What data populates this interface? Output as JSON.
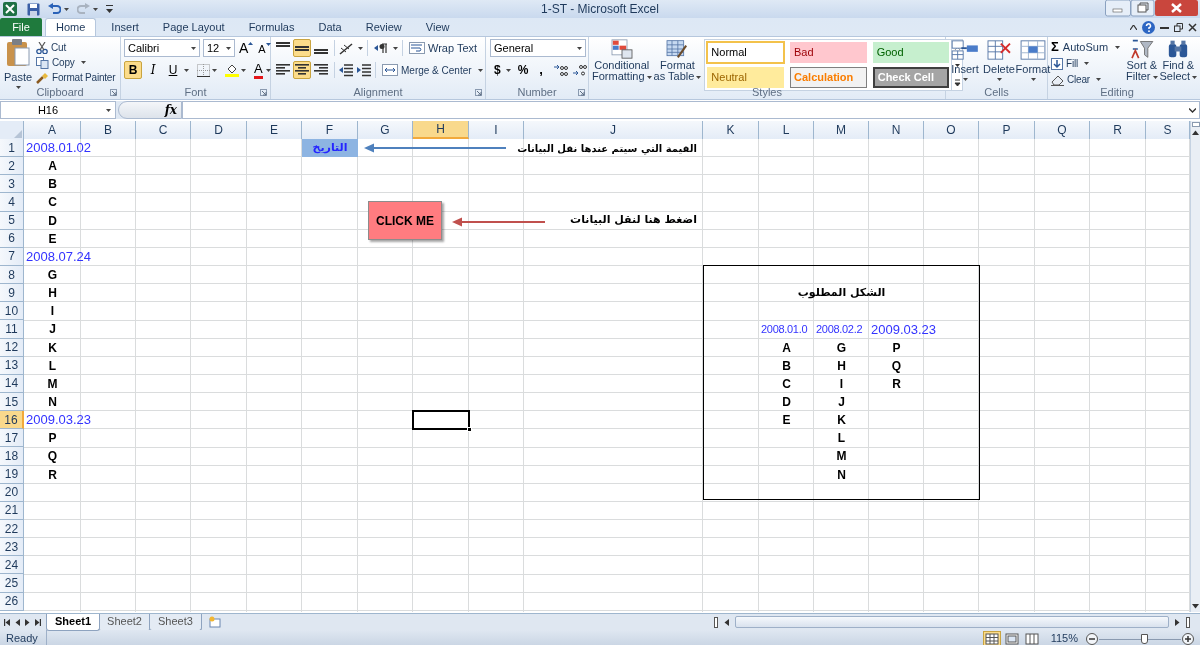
{
  "window": {
    "title": "1-ST - Microsoft Excel"
  },
  "tabs": [
    {
      "label": "File",
      "kind": "file",
      "selected": false
    },
    {
      "label": "Home",
      "kind": "tab",
      "selected": true
    },
    {
      "label": "Insert",
      "kind": "tab",
      "selected": false
    },
    {
      "label": "Page Layout",
      "kind": "tab",
      "selected": false
    },
    {
      "label": "Formulas",
      "kind": "tab",
      "selected": false
    },
    {
      "label": "Data",
      "kind": "tab",
      "selected": false
    },
    {
      "label": "Review",
      "kind": "tab",
      "selected": false
    },
    {
      "label": "View",
      "kind": "tab",
      "selected": false
    }
  ],
  "ribbon": {
    "clipboard": {
      "label": "Clipboard",
      "paste": "Paste",
      "cut": "Cut",
      "copy": "Copy",
      "format_painter": "Format Painter"
    },
    "font": {
      "label": "Font",
      "font_name": "Calibri",
      "font_size": "12",
      "grow": "A",
      "shrink": "A",
      "bold": {
        "text": "B",
        "selected": true
      },
      "italic": {
        "text": "I",
        "selected": false
      },
      "underline": {
        "text": "U",
        "selected": false
      },
      "font_color": "A"
    },
    "alignment": {
      "label": "Alignment",
      "vertical": [
        {
          "selected": false
        },
        {
          "selected": true
        },
        {
          "selected": false
        }
      ],
      "horizontal": [
        {
          "selected": false
        },
        {
          "selected": true
        },
        {
          "selected": false
        }
      ],
      "wrap_text": "Wrap Text",
      "merge_center": "Merge & Center"
    },
    "number": {
      "label": "Number",
      "format": "General",
      "currency": "$",
      "percent": "%",
      "comma": ","
    },
    "styles": {
      "label": "Styles",
      "conditional_formatting": [
        "Conditional",
        "Formatting"
      ],
      "format_as_table": [
        "Format",
        "as Table"
      ],
      "gallery": [
        {
          "label": "Normal",
          "kind": "normal",
          "selected": true
        },
        {
          "label": "Bad",
          "kind": "bad",
          "selected": false
        },
        {
          "label": "Good",
          "kind": "good",
          "selected": false
        },
        {
          "label": "Neutral",
          "kind": "neutral",
          "selected": false
        },
        {
          "label": "Calculation",
          "kind": "calculation",
          "selected": false
        },
        {
          "label": "Check Cell",
          "kind": "check",
          "selected": false
        }
      ]
    },
    "cells": {
      "label": "Cells",
      "buttons": [
        "Insert",
        "Delete",
        "Format"
      ]
    },
    "editing": {
      "label": "Editing",
      "autosum": {
        "symbol": "Σ",
        "text": "AutoSum"
      },
      "fill": "Fill",
      "clear": "Clear",
      "sort_filter": [
        "Sort &",
        "Filter"
      ],
      "find_select": [
        "Find &",
        "Select"
      ]
    }
  },
  "formula_bar": {
    "name_box": "H16",
    "function_label": "fx"
  },
  "sheet": {
    "columns": [
      {
        "label": "A",
        "selected": false
      },
      {
        "label": "B",
        "selected": false
      },
      {
        "label": "C",
        "selected": false
      },
      {
        "label": "D",
        "selected": false
      },
      {
        "label": "E",
        "selected": false
      },
      {
        "label": "F",
        "selected": false
      },
      {
        "label": "G",
        "selected": false
      },
      {
        "label": "H",
        "selected": true
      },
      {
        "label": "I",
        "selected": false
      },
      {
        "label": "J",
        "selected": false
      },
      {
        "label": "K",
        "selected": false
      },
      {
        "label": "L",
        "selected": false
      },
      {
        "label": "M",
        "selected": false
      },
      {
        "label": "N",
        "selected": false
      },
      {
        "label": "O",
        "selected": false
      },
      {
        "label": "P",
        "selected": false
      },
      {
        "label": "Q",
        "selected": false
      },
      {
        "label": "R",
        "selected": false
      },
      {
        "label": "S",
        "selected": false
      }
    ],
    "rows": [
      {
        "label": "1",
        "selected": false,
        "cells": {
          "A": {
            "text": "2008.01.02",
            "kind": "date"
          },
          "F": {
            "text": "التاريخ",
            "kind": "heading"
          },
          "J": {
            "text": "القيمة التي سيتم عندها نقل البيانات",
            "kind": "note"
          }
        }
      },
      {
        "label": "2",
        "selected": false,
        "cells": {
          "A": {
            "text": "A",
            "kind": "letter"
          }
        }
      },
      {
        "label": "3",
        "selected": false,
        "cells": {
          "A": {
            "text": "B",
            "kind": "letter"
          }
        }
      },
      {
        "label": "4",
        "selected": false,
        "cells": {
          "A": {
            "text": "C",
            "kind": "letter"
          }
        }
      },
      {
        "label": "5",
        "selected": false,
        "cells": {
          "A": {
            "text": "D",
            "kind": "letter"
          },
          "J": {
            "text": "اضغط هنا لنقل البيانات",
            "kind": "label"
          }
        }
      },
      {
        "label": "6",
        "selected": false,
        "cells": {
          "A": {
            "text": "E",
            "kind": "letter"
          }
        }
      },
      {
        "label": "7",
        "selected": false,
        "cells": {
          "A": {
            "text": "2008.07.24",
            "kind": "date"
          }
        }
      },
      {
        "label": "8",
        "selected": false,
        "cells": {
          "A": {
            "text": "G",
            "kind": "letter"
          }
        }
      },
      {
        "label": "9",
        "selected": false,
        "cells": {
          "A": {
            "text": "H",
            "kind": "letter"
          },
          "M": {
            "text": "الشكل المطلوب",
            "kind": "title"
          }
        }
      },
      {
        "label": "10",
        "selected": false,
        "cells": {
          "A": {
            "text": "I",
            "kind": "letter"
          }
        }
      },
      {
        "label": "11",
        "selected": false,
        "cells": {
          "A": {
            "text": "J",
            "kind": "letter"
          },
          "L": {
            "text": "2008.01.0",
            "kind": "date"
          },
          "M": {
            "text": "2008.02.2",
            "kind": "date"
          },
          "N": {
            "text": "2009.03.23",
            "kind": "date"
          }
        }
      },
      {
        "label": "12",
        "selected": false,
        "cells": {
          "A": {
            "text": "K",
            "kind": "letter"
          },
          "L": {
            "text": "A",
            "kind": "letter"
          },
          "M": {
            "text": "G",
            "kind": "letter"
          },
          "N": {
            "text": "P",
            "kind": "letter"
          }
        }
      },
      {
        "label": "13",
        "selected": false,
        "cells": {
          "A": {
            "text": "L",
            "kind": "letter"
          },
          "L": {
            "text": "B",
            "kind": "letter"
          },
          "M": {
            "text": "H",
            "kind": "letter"
          },
          "N": {
            "text": "Q",
            "kind": "letter"
          }
        }
      },
      {
        "label": "14",
        "selected": false,
        "cells": {
          "A": {
            "text": "M",
            "kind": "letter"
          },
          "L": {
            "text": "C",
            "kind": "letter"
          },
          "M": {
            "text": "I",
            "kind": "letter"
          },
          "N": {
            "text": "R",
            "kind": "letter"
          }
        }
      },
      {
        "label": "15",
        "selected": false,
        "cells": {
          "A": {
            "text": "N",
            "kind": "letter"
          },
          "L": {
            "text": "D",
            "kind": "letter"
          },
          "M": {
            "text": "J",
            "kind": "letter"
          }
        }
      },
      {
        "label": "16",
        "selected": true,
        "cells": {
          "A": {
            "text": "2009.03.23",
            "kind": "date"
          },
          "L": {
            "text": "E",
            "kind": "letter"
          },
          "M": {
            "text": "K",
            "kind": "letter"
          }
        }
      },
      {
        "label": "17",
        "selected": false,
        "cells": {
          "A": {
            "text": "P",
            "kind": "letter"
          },
          "M": {
            "text": "L",
            "kind": "letter"
          }
        }
      },
      {
        "label": "18",
        "selected": false,
        "cells": {
          "A": {
            "text": "Q",
            "kind": "letter"
          },
          "M": {
            "text": "M",
            "kind": "letter"
          }
        }
      },
      {
        "label": "19",
        "selected": false,
        "cells": {
          "A": {
            "text": "R",
            "kind": "letter"
          },
          "M": {
            "text": "N",
            "kind": "letter"
          }
        }
      },
      {
        "label": "20",
        "selected": false
      },
      {
        "label": "21",
        "selected": false
      },
      {
        "label": "22",
        "selected": false
      },
      {
        "label": "23",
        "selected": false
      },
      {
        "label": "24",
        "selected": false
      },
      {
        "label": "25",
        "selected": false
      },
      {
        "label": "26",
        "selected": false
      }
    ],
    "shapes": [
      {
        "kind": "button",
        "text": "CLICK ME"
      },
      {
        "kind": "arrow",
        "color": "#4f81bd"
      },
      {
        "kind": "arrow",
        "color": "#c0504d"
      },
      {
        "kind": "frame"
      }
    ]
  },
  "sheet_tabs": [
    {
      "label": "Sheet1",
      "selected": true
    },
    {
      "label": "Sheet2",
      "selected": false
    },
    {
      "label": "Sheet3",
      "selected": false
    }
  ],
  "status_bar": {
    "status": "Ready",
    "views": [
      {
        "selected": true
      },
      {
        "selected": false
      },
      {
        "selected": false
      }
    ],
    "zoom": "115%",
    "zoom_slider": {
      "level": 0.55
    }
  }
}
